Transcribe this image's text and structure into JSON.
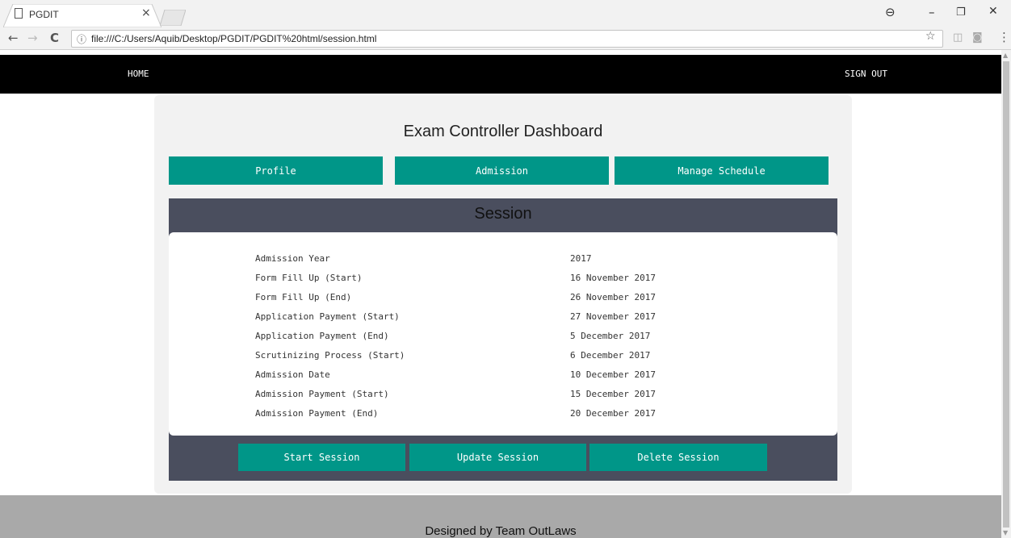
{
  "browser": {
    "tab_title": "PGDIT",
    "tab_close": "×",
    "url": "file:///C:/Users/Aquib/Desktop/PGDIT/PGDIT%20html/session.html",
    "info_glyph": "ⓘ",
    "back": "←",
    "forward": "→",
    "reload": "C",
    "star": "☆",
    "menu": "⋮",
    "profile": "⊖",
    "minimize": "–",
    "restore": "❐",
    "close": "✕"
  },
  "nav": {
    "home": "HOME",
    "signout": "SIGN OUT"
  },
  "dashboard": {
    "title": "Exam Controller Dashboard",
    "tabs": [
      {
        "label": "Profile"
      },
      {
        "label": "Admission"
      },
      {
        "label": "Manage Schedule"
      }
    ]
  },
  "session": {
    "title": "Session",
    "rows": [
      {
        "key": "Admission Year",
        "value": "2017"
      },
      {
        "key": "Form Fill Up (Start)",
        "value": "16 November 2017"
      },
      {
        "key": "Form Fill Up (End)",
        "value": "26 November 2017"
      },
      {
        "key": "Application Payment (Start)",
        "value": "27 November 2017"
      },
      {
        "key": "Application Payment (End)",
        "value": "5 December 2017"
      },
      {
        "key": "Scrutinizing Process (Start)",
        "value": "6 December 2017"
      },
      {
        "key": "Admission Date",
        "value": "10 December 2017"
      },
      {
        "key": "Admission Payment (Start)",
        "value": "15 December 2017"
      },
      {
        "key": "Admission Payment (End)",
        "value": "20 December 2017"
      }
    ],
    "actions": [
      {
        "label": "Start Session"
      },
      {
        "label": "Update Session"
      },
      {
        "label": "Delete Session"
      }
    ]
  },
  "footer": {
    "text": "Designed by Team OutLaws"
  },
  "colors": {
    "accent": "#009688",
    "nav_bg": "#000000",
    "session_bg": "#4a4e5e",
    "footer_bg": "#a9a9a9"
  }
}
